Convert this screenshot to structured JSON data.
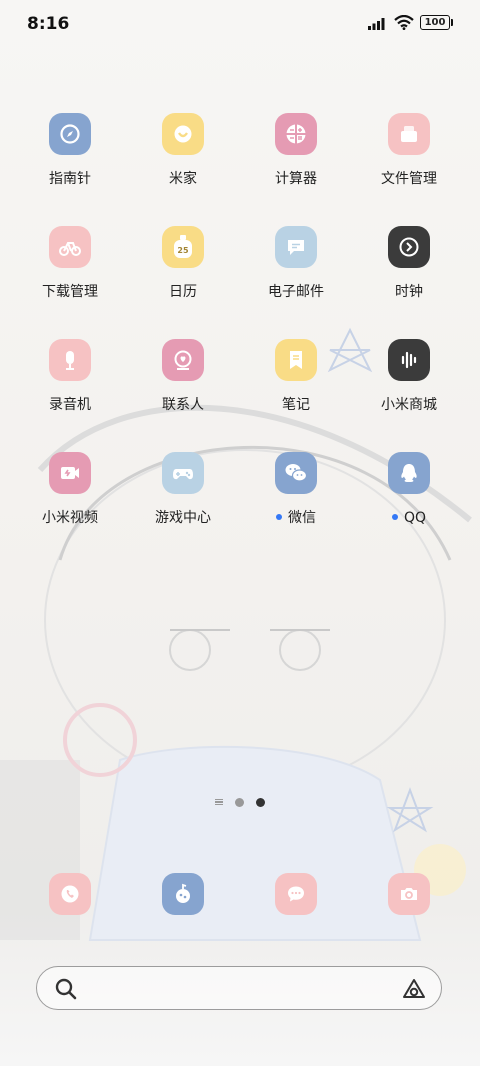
{
  "status_bar": {
    "time": "8:16",
    "battery": "100"
  },
  "colors": {
    "blue": "#86a4cf",
    "yellow": "#f9dc86",
    "pink": "#e59bb3",
    "peach": "#f6c2c3",
    "lightblue": "#b9d2e4",
    "dark": "#3b3b3b",
    "dot": "#3478f6"
  },
  "apps": [
    {
      "label": "指南针",
      "icon": "compass-icon"
    },
    {
      "label": "米家",
      "icon": "mijia-icon"
    },
    {
      "label": "计算器",
      "icon": "calculator-icon"
    },
    {
      "label": "文件管理",
      "icon": "file-manager-icon"
    },
    {
      "label": "下载管理",
      "icon": "download-bike-icon"
    },
    {
      "label": "日历",
      "icon": "calendar-icon",
      "badge": "25"
    },
    {
      "label": "电子邮件",
      "icon": "email-icon"
    },
    {
      "label": "时钟",
      "icon": "clock-icon"
    },
    {
      "label": "录音机",
      "icon": "recorder-icon"
    },
    {
      "label": "联系人",
      "icon": "contacts-icon"
    },
    {
      "label": "笔记",
      "icon": "notes-icon"
    },
    {
      "label": "小米商城",
      "icon": "mi-store-icon"
    },
    {
      "label": "小米视频",
      "icon": "video-icon"
    },
    {
      "label": "游戏中心",
      "icon": "game-center-icon"
    },
    {
      "label": "微信",
      "icon": "wechat-icon",
      "new": true
    },
    {
      "label": "QQ",
      "icon": "qq-icon",
      "new": true
    }
  ],
  "dock": [
    {
      "icon": "phone-icon"
    },
    {
      "icon": "browser-icon"
    },
    {
      "icon": "messages-icon"
    },
    {
      "icon": "camera-icon"
    }
  ],
  "search": {
    "placeholder": ""
  }
}
